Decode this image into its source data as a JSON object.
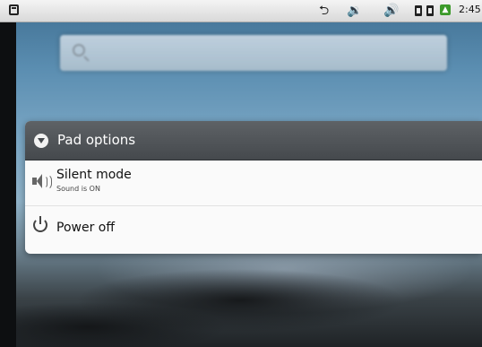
{
  "status_bar": {
    "time": "2:45"
  },
  "dialog": {
    "title": "Pad options",
    "items": [
      {
        "label": "Silent mode",
        "sublabel": "Sound is ON",
        "icon": "speaker-icon"
      },
      {
        "label": "Power off",
        "icon": "power-icon"
      }
    ]
  },
  "colors": {
    "header_bg": "#45494d",
    "dialog_bg": "#fafafa",
    "signal_green": "#3c9a2a"
  }
}
